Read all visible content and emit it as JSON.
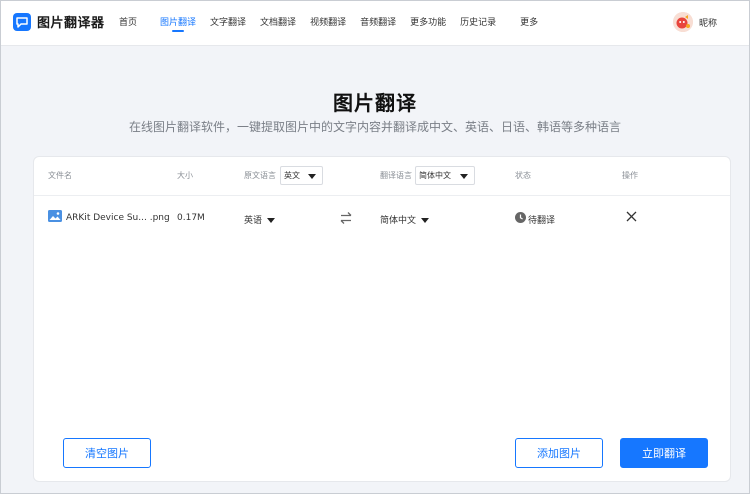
{
  "header": {
    "logo_text": "图片翻译器",
    "nav": [
      {
        "label": "首页",
        "active": false
      },
      {
        "label": "图片翻译",
        "active": true
      },
      {
        "label": "文字翻译",
        "active": false
      },
      {
        "label": "文档翻译",
        "active": false
      },
      {
        "label": "视频翻译",
        "active": false
      },
      {
        "label": "音频翻译",
        "active": false
      },
      {
        "label": "更多功能",
        "active": false
      },
      {
        "label": "历史记录",
        "active": false
      },
      {
        "label": "更多",
        "active": false
      }
    ],
    "user_name": "昵称"
  },
  "page": {
    "title": "图片翻译",
    "subtitle": "在线图片翻译软件，一键提取图片中的文字内容并翻译成中文、英语、日语、韩语等多种语言"
  },
  "table": {
    "headers": {
      "file_name": "文件名",
      "size": "大小",
      "source_lang": "原文语言",
      "target_lang": "翻译语言",
      "status": "状态",
      "action": "操作"
    },
    "source_lang_select": "英文",
    "target_lang_select": "简体中文",
    "rows": [
      {
        "file_name": "ARKit Device Su... .png",
        "size": "0.17M",
        "source_lang": "英语",
        "target_lang": "简体中文",
        "status": "待翻译"
      }
    ]
  },
  "buttons": {
    "clear": "清空图片",
    "add": "添加图片",
    "translate": "立即翻译"
  },
  "colors": {
    "accent": "#1677ff",
    "background": "#f2f4f8"
  }
}
